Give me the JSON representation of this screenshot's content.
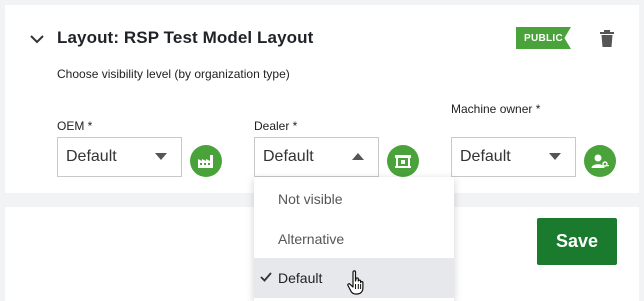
{
  "layout": {
    "title": "Layout: RSP Test Model Layout",
    "badge": "PUBLIC",
    "subtitle": "Choose visibility level (by organization type)"
  },
  "fields": {
    "oem": {
      "label": "OEM *",
      "value": "Default",
      "icon": "factory-icon"
    },
    "dealer": {
      "label": "Dealer *",
      "value": "Default",
      "icon": "store-icon",
      "open": true
    },
    "machine_owner": {
      "label": "Machine owner *",
      "value": "Default",
      "icon": "user-key-icon"
    }
  },
  "dropdown": {
    "options": [
      "Not visible",
      "Alternative",
      "Default"
    ],
    "selected": "Default"
  },
  "actions": {
    "save_label": "Save"
  },
  "colors": {
    "accent_green": "#4aa33a",
    "save_green": "#1a7a2e",
    "background": "#f2f3f5"
  }
}
